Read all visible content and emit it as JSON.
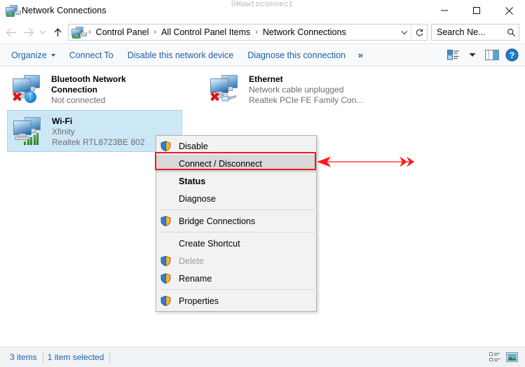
{
  "window": {
    "title": "Network Connections",
    "title_icon": "network-connections-icon",
    "watermark": "©Howtoconnect",
    "minimize_label": "Minimize",
    "maximize_label": "Maximize",
    "close_label": "Close"
  },
  "navigation": {
    "back_label": "Back",
    "forward_label": "Forward",
    "recent_label": "Recent locations",
    "up_label": "Up"
  },
  "address": {
    "icon": "network-connections-icon",
    "crumbs": [
      "Control Panel",
      "All Control Panel Items",
      "Network Connections"
    ],
    "separator": "›",
    "dropdown_icon": "chevron-down-icon",
    "refresh_icon": "refresh-icon"
  },
  "search": {
    "value": "Search Ne...",
    "placeholder": "Search Network Connections",
    "icon": "search-icon"
  },
  "commandbar": {
    "items": [
      {
        "label": "Organize",
        "has_caret": true
      },
      {
        "label": "Connect To",
        "has_caret": false
      },
      {
        "label": "Disable this network device",
        "has_caret": false
      },
      {
        "label": "Diagnose this connection",
        "has_caret": false
      }
    ],
    "overflow_label": "»",
    "view_icon": "change-view-icon",
    "view_caret_icon": "chevron-down-icon",
    "preview_pane_icon": "preview-pane-icon",
    "help_icon": "help-icon"
  },
  "connections": [
    {
      "name": "Bluetooth Network Connection",
      "name_line1": "Bluetooth Network",
      "name_line2": "Connection",
      "status": "Not connected",
      "device": "",
      "badge": "bluetooth",
      "disconnected": true,
      "selected": false
    },
    {
      "name": "Ethernet",
      "name_line1": "Ethernet",
      "name_line2": "",
      "status": "Network cable unplugged",
      "device": "Realtek PCIe FE Family Con...",
      "badge": "ethernet",
      "disconnected": true,
      "selected": false
    },
    {
      "name": "Wi-Fi",
      "name_line1": "Wi-Fi",
      "name_line2": "",
      "status": "Xfinity",
      "device": "Realtek RTL8723BE 802",
      "badge": "wifi",
      "disconnected": false,
      "selected": true
    }
  ],
  "context_menu": {
    "items": [
      {
        "label": "Disable",
        "shield": true,
        "bold": false,
        "disabled": false,
        "highlighted": false
      },
      {
        "label": "Connect / Disconnect",
        "shield": false,
        "bold": false,
        "disabled": false,
        "highlighted": true
      },
      {
        "label": "Status",
        "shield": false,
        "bold": true,
        "disabled": false,
        "highlighted": false
      },
      {
        "label": "Diagnose",
        "shield": false,
        "bold": false,
        "disabled": false,
        "highlighted": false
      },
      {
        "separator": true
      },
      {
        "label": "Bridge Connections",
        "shield": true,
        "bold": false,
        "disabled": false,
        "highlighted": false
      },
      {
        "separator": true
      },
      {
        "label": "Create Shortcut",
        "shield": false,
        "bold": false,
        "disabled": false,
        "highlighted": false
      },
      {
        "label": "Delete",
        "shield": true,
        "bold": false,
        "disabled": true,
        "highlighted": false
      },
      {
        "label": "Rename",
        "shield": true,
        "bold": false,
        "disabled": false,
        "highlighted": false
      },
      {
        "separator": true
      },
      {
        "label": "Properties",
        "shield": true,
        "bold": false,
        "disabled": false,
        "highlighted": false
      }
    ]
  },
  "annotation": {
    "highlight_color": "#ef1b1b",
    "arrow_color": "#ff3b30",
    "target": "Connect / Disconnect"
  },
  "statusbar": {
    "item_count": "3 items",
    "selection": "1 item selected",
    "details_view_icon": "details-view-icon",
    "large-icons_view_icon": "large-icons-view-icon"
  }
}
